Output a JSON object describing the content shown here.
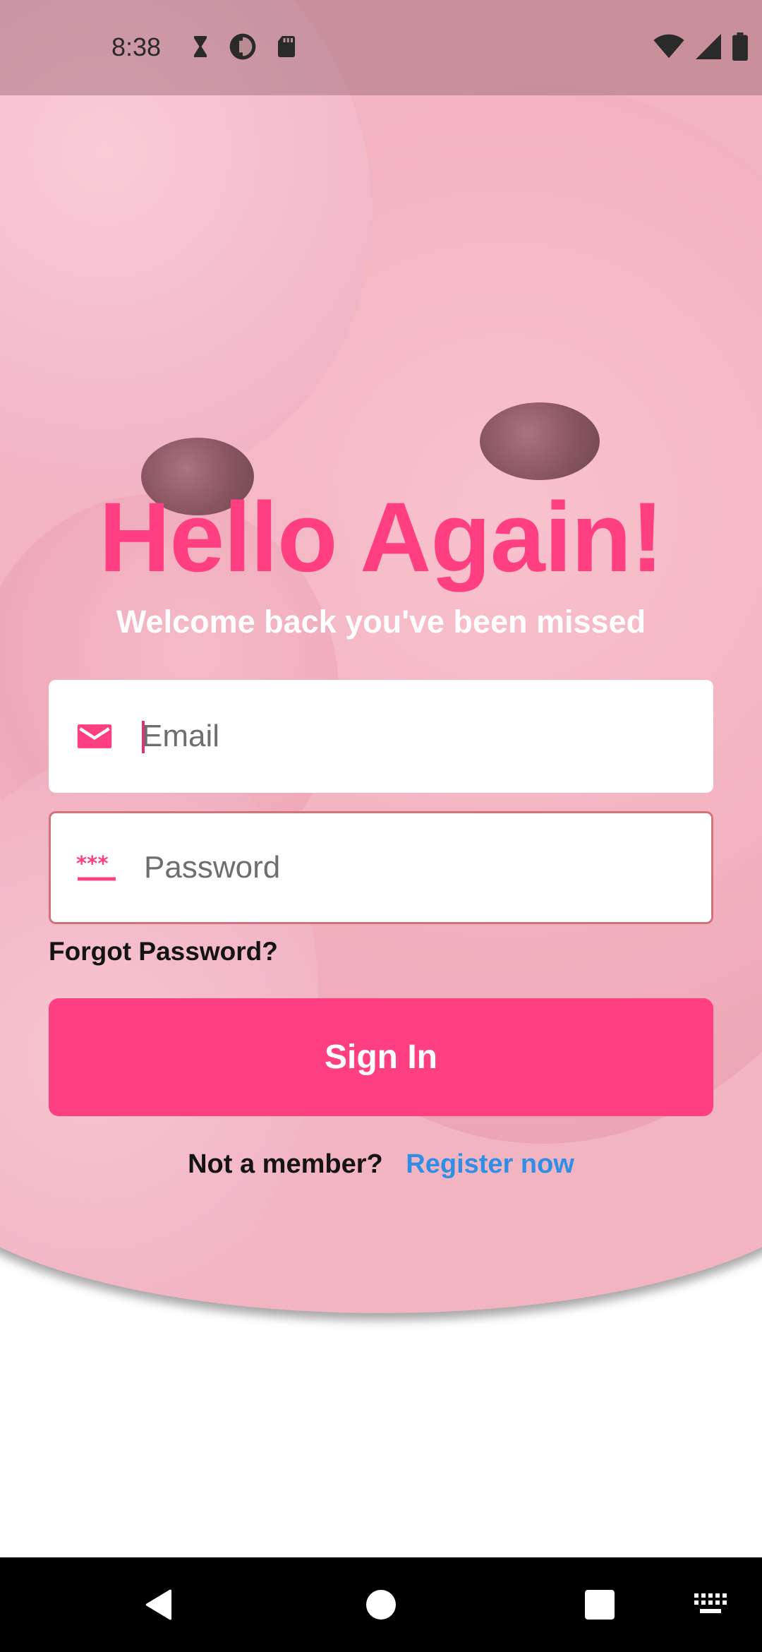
{
  "status_bar": {
    "time": "8:38",
    "left_icons": [
      "hourglass-icon",
      "data-saver-icon",
      "sd-card-icon"
    ],
    "right_icons": [
      "wifi-icon",
      "signal-icon",
      "battery-icon"
    ]
  },
  "login": {
    "title": "Hello Again!",
    "subtitle": "Welcome back you've been missed",
    "email": {
      "placeholder": "Email",
      "value": "",
      "icon": "mail-icon"
    },
    "password": {
      "placeholder": "Password",
      "value": "",
      "icon": "password-icon"
    },
    "forgot_label": "Forgot Password?",
    "signin_label": "Sign In",
    "not_member_text": "Not a member?",
    "register_link": "Register now"
  },
  "nav_bar": {
    "buttons": [
      "back-icon",
      "home-icon",
      "recents-icon",
      "keyboard-icon"
    ]
  },
  "colors": {
    "accent": "#ff3f82",
    "link": "#2f8fe6",
    "password_border": "#d2727c"
  }
}
